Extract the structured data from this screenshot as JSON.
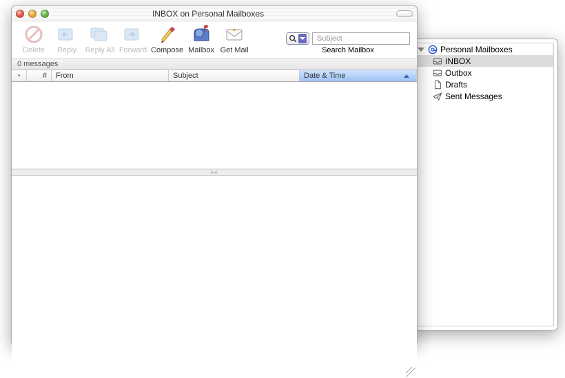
{
  "window": {
    "title": "INBOX on Personal Mailboxes"
  },
  "toolbar": {
    "delete": "Delete",
    "reply": "Reply",
    "reply_all": "Reply All",
    "forward": "Forward",
    "compose": "Compose",
    "mailbox": "Mailbox",
    "get_mail": "Get Mail",
    "search_label": "Search Mailbox",
    "search_placeholder": "Subject"
  },
  "status": {
    "message_count": "0 messages"
  },
  "columns": {
    "hash": "#",
    "from": "From",
    "subject": "Subject",
    "date": "Date & Time",
    "sort_column": "date",
    "sort_direction": "ascending"
  },
  "tree": {
    "root_label": "Personal Mailboxes",
    "items": [
      {
        "label": "INBOX",
        "icon": "tray",
        "selected": true
      },
      {
        "label": "Outbox",
        "icon": "tray",
        "selected": false
      },
      {
        "label": "Drafts",
        "icon": "page",
        "selected": false
      },
      {
        "label": "Sent Messages",
        "icon": "plane",
        "selected": false
      }
    ]
  }
}
